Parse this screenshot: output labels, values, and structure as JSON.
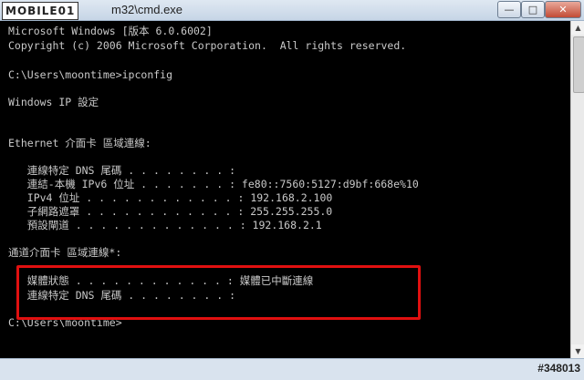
{
  "window": {
    "logo": "MOBILE01",
    "title": "m32\\cmd.exe",
    "minimize": "—",
    "maximize": "□",
    "close": "✕"
  },
  "console_lines": [
    "Microsoft Windows [版本 6.0.6002]",
    "Copyright (c) 2006 Microsoft Corporation.  All rights reserved.",
    "",
    "C:\\Users\\moontime>ipconfig",
    "",
    "Windows IP 設定",
    "",
    "",
    "Ethernet 介面卡 區域連線:",
    "",
    "   連線特定 DNS 尾碼 . . . . . . . . :",
    "   連結-本機 IPv6 位址 . . . . . . . : fe80::7560:5127:d9bf:668e%10",
    "   IPv4 位址 . . . . . . . . . . . . : 192.168.2.100",
    "   子網路遮罩 . . . . . . . . . . . . : 255.255.255.0",
    "   預設閘道 . . . . . . . . . . . . . : 192.168.2.1",
    "",
    "通道介面卡 區域連線*:",
    "",
    "   媒體狀態 . . . . . . . . . . . . : 媒體已中斷連線",
    "   連線特定 DNS 尾碼 . . . . . . . . :",
    "",
    "C:\\Users\\moontime>"
  ],
  "scrollbar": {
    "up": "▲",
    "down": "▼"
  },
  "watermark": "#348013",
  "colors": {
    "console_bg": "#000000",
    "console_text": "#c9c9c9",
    "highlight": "#e01010"
  }
}
